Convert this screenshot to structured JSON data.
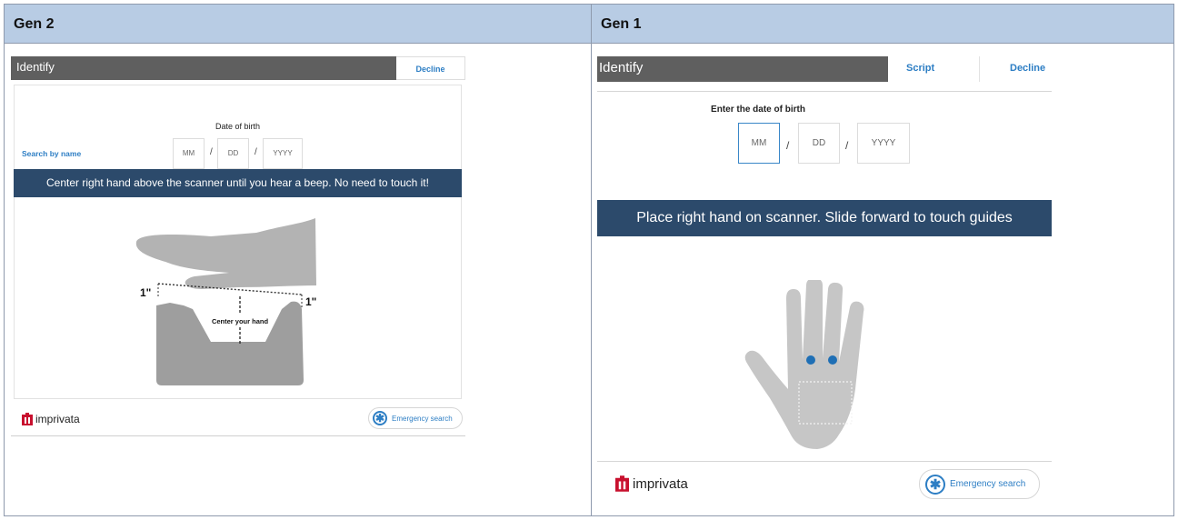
{
  "columns": [
    "Gen 2",
    "Gen 1"
  ],
  "gen2": {
    "header_title": "Identify",
    "decline_label": "Decline",
    "dob_label": "Date of birth",
    "dob_placeholders": {
      "month": "MM",
      "day": "DD",
      "year": "YYYY"
    },
    "slash": "/",
    "search_by_name": "Search by name",
    "instruction": "Center right hand above the scanner until you hear a beep. No need to touch it!",
    "illustration": {
      "left_measure": "1\"",
      "right_measure": "1\"",
      "center_label": "Center your hand"
    },
    "logo_text": "imprivata",
    "emergency_label": "Emergency search"
  },
  "gen1": {
    "header_title": "Identify",
    "script_label": "Script",
    "decline_label": "Decline",
    "dob_label": "Enter the date of birth",
    "dob_placeholders": {
      "month": "MM",
      "day": "DD",
      "year": "YYYY"
    },
    "slash": "/",
    "instruction": "Place right hand on scanner. Slide forward to touch guides",
    "logo_text": "imprivata",
    "emergency_label": "Emergency search"
  },
  "colors": {
    "header_row": "#b8cce4",
    "title_bar": "#5f5f5f",
    "banner": "#2c4a6b",
    "accent": "#2d7ec4",
    "illustration_gray": "#b3b3b3",
    "logo_red": "#c8102e"
  },
  "icons": [
    "asterisk-icon",
    "imprivata-logo-icon",
    "hand-illustration",
    "scanner-illustration"
  ]
}
